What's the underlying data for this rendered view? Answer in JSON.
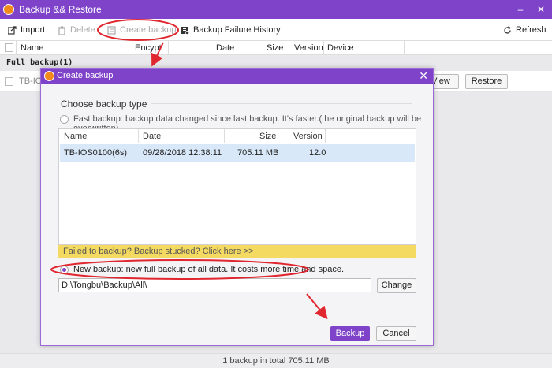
{
  "window": {
    "title": "Backup && Restore"
  },
  "toolbar": {
    "import": "Import",
    "delete": "Delete",
    "create_backup": "Create backup",
    "failure_history": "Backup Failure History",
    "refresh": "Refresh"
  },
  "columns": {
    "name": "Name",
    "encrypt": "Encypt",
    "date": "Date",
    "size": "Size",
    "version": "Version",
    "device": "Device"
  },
  "group": {
    "label": "Full backup(1)"
  },
  "backup_row": {
    "name": "TB-IOS",
    "view": "View",
    "restore": "Restore"
  },
  "status": {
    "text": "1 backup in total 705.11 MB"
  },
  "dialog": {
    "title": "Create backup",
    "section_title": "Choose backup type",
    "fast_option": "Fast backup: backup data changed since last backup. It's faster.(the original backup will be overwritten)",
    "list_headers": {
      "name": "Name",
      "date": "Date",
      "size": "Size",
      "version": "Version"
    },
    "list_row": {
      "name": "TB-IOS0100(6s)",
      "date": "09/28/2018 12:38:11",
      "size": "705.11 MB",
      "version": "12.0"
    },
    "warning": "Failed to backup? Backup stucked? Click here >>",
    "new_option": "New backup: new full backup of all data. It costs more time and space.",
    "path": "D:\\Tongbu\\Backup\\All\\",
    "change": "Change",
    "backup": "Backup",
    "cancel": "Cancel"
  },
  "colors": {
    "accent": "#7e43c8",
    "warning_bg": "#f5da62",
    "annotation": "#e0262f"
  },
  "icons": [
    "app-icon",
    "import-icon",
    "delete-icon",
    "create-backup-icon",
    "failure-history-icon",
    "refresh-icon",
    "close-icon",
    "minimize-icon",
    "maximize-icon"
  ]
}
